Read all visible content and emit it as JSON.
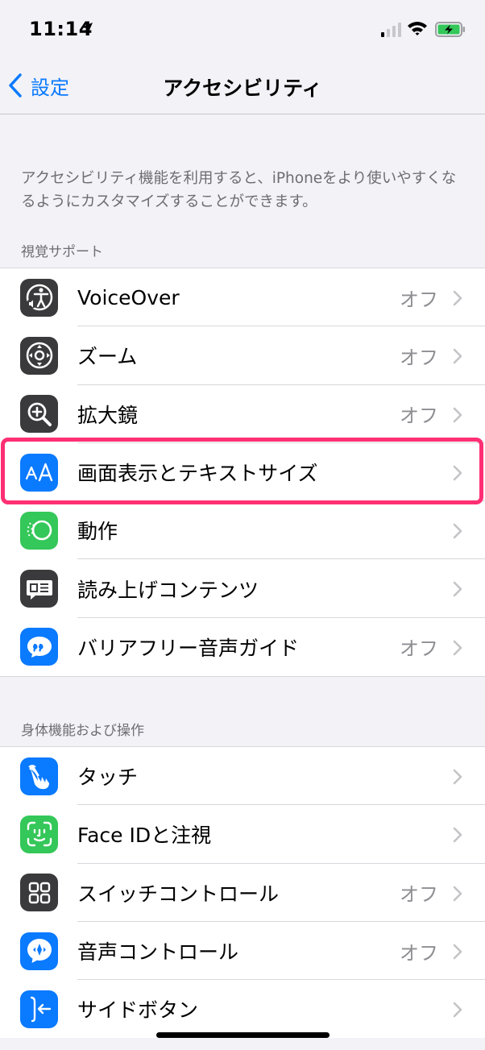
{
  "status": {
    "time": "11:14"
  },
  "nav": {
    "back_label": "設定",
    "title": "アクセシビリティ"
  },
  "description": "アクセシビリティ機能を利用すると、iPhoneをより使いやすくなるようにカスタマイズすることができます。",
  "sections": [
    {
      "header": "視覚サポート",
      "items": [
        {
          "label": "VoiceOver",
          "value": "オフ",
          "icon": "voiceover-icon",
          "color": "#3a3a3c"
        },
        {
          "label": "ズーム",
          "value": "オフ",
          "icon": "zoom-icon",
          "color": "#3a3a3c"
        },
        {
          "label": "拡大鏡",
          "value": "オフ",
          "icon": "magnifier-icon",
          "color": "#3a3a3c"
        },
        {
          "label": "画面表示とテキストサイズ",
          "value": "",
          "icon": "text-size-icon",
          "color": "#0a7aff"
        },
        {
          "label": "動作",
          "value": "",
          "icon": "motion-icon",
          "color": "#34c759"
        },
        {
          "label": "読み上げコンテンツ",
          "value": "",
          "icon": "spoken-content-icon",
          "color": "#3a3a3c"
        },
        {
          "label": "バリアフリー音声ガイド",
          "value": "オフ",
          "icon": "audio-description-icon",
          "color": "#0a7aff"
        }
      ]
    },
    {
      "header": "身体機能および操作",
      "items": [
        {
          "label": "タッチ",
          "value": "",
          "icon": "touch-icon",
          "color": "#0a7aff"
        },
        {
          "label": "Face IDと注視",
          "value": "",
          "icon": "face-id-icon",
          "color": "#34c759"
        },
        {
          "label": "スイッチコントロール",
          "value": "オフ",
          "icon": "switch-control-icon",
          "color": "#3a3a3c"
        },
        {
          "label": "音声コントロール",
          "value": "オフ",
          "icon": "voice-control-icon",
          "color": "#0a7aff"
        },
        {
          "label": "サイドボタン",
          "value": "",
          "icon": "side-button-icon",
          "color": "#0a7aff"
        }
      ]
    }
  ],
  "colors": {
    "accent": "#0a7aff",
    "highlight": "#ff2f74"
  }
}
